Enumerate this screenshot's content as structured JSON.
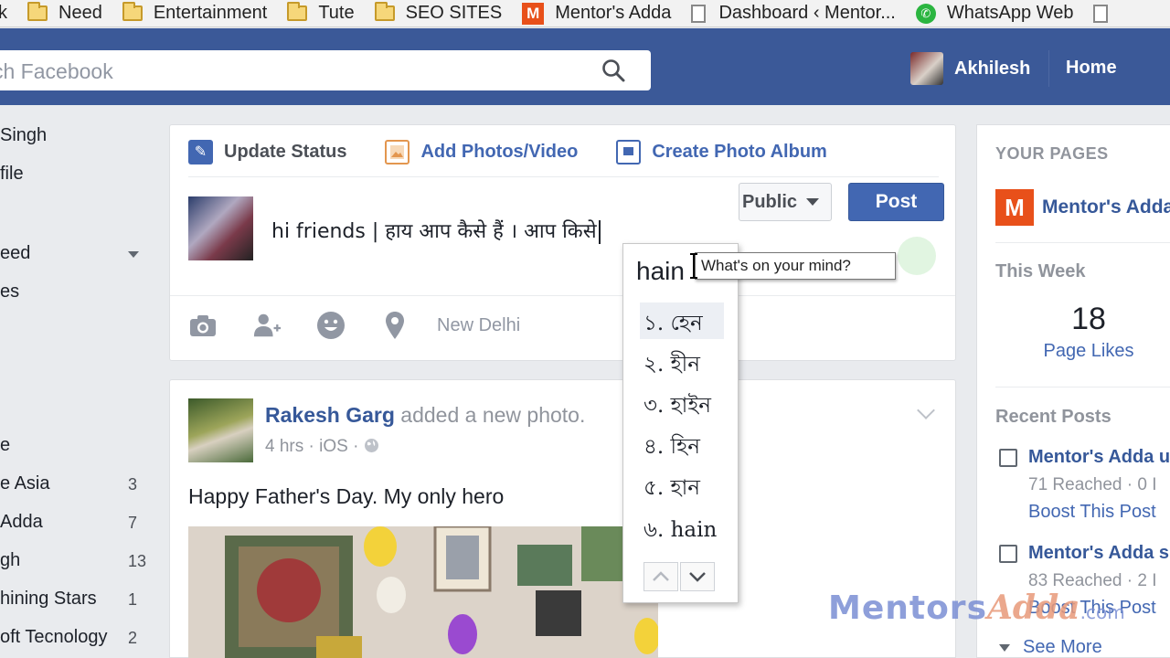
{
  "bookmarks": [
    {
      "label": "k",
      "icon": "none"
    },
    {
      "label": "Need",
      "icon": "folder-icon"
    },
    {
      "label": "Entertainment",
      "icon": "folder-icon"
    },
    {
      "label": "Tute",
      "icon": "folder-icon"
    },
    {
      "label": "SEO SITES",
      "icon": "folder-icon"
    },
    {
      "label": "Mentor's Adda",
      "icon": "mentors-adda-logo"
    },
    {
      "label": "Dashboard ‹ Mentor...",
      "icon": "page-icon"
    },
    {
      "label": "WhatsApp Web",
      "icon": "whatsapp-icon"
    }
  ],
  "topbar": {
    "search_placeholder": "ch Facebook",
    "user_name": "Akhilesh",
    "home_label": "Home"
  },
  "leftnav": {
    "items": [
      {
        "label": "Singh"
      },
      {
        "label": "file"
      },
      {
        "label": "eed"
      },
      {
        "label": "es"
      },
      {
        "label": "e"
      },
      {
        "label": "e Asia",
        "count": "3"
      },
      {
        "label": " Adda",
        "count": "7"
      },
      {
        "label": "gh",
        "count": "13"
      },
      {
        "label": "hining Stars",
        "count": "1"
      },
      {
        "label": "oft Tecnology",
        "count": "2"
      }
    ]
  },
  "composer": {
    "tabs": [
      {
        "label": "Update Status"
      },
      {
        "label": "Add Photos/Video"
      },
      {
        "label": "Create Photo Album"
      }
    ],
    "text": "hi friends | हाय आप कैसे हैं । आप किसे",
    "location": "New Delhi",
    "audience": "Public",
    "post_label": "Post"
  },
  "ime": {
    "typed": "hain",
    "suggestions": [
      "১. হেন",
      "২. হীন",
      "৩. হাইন",
      "৪. হিন",
      "৫. হান",
      "৬. hain"
    ],
    "selected_index": 0
  },
  "tooltip": "What's on your mind?",
  "feed": {
    "author": "Rakesh Garg",
    "action": "added a new photo.",
    "meta": "4 hrs · iOS ·",
    "text": "Happy Father's Day. My only hero"
  },
  "rightbar": {
    "pages_heading": "YOUR PAGES",
    "page_name": "Mentor's Adda",
    "this_week": "This Week",
    "likes_count": "18",
    "likes_label": "Page Likes",
    "recent_heading": "Recent Posts",
    "posts": [
      {
        "title": "Mentor's Adda u",
        "stat": "71 Reached · 0 I",
        "boost": "Boost This Post"
      },
      {
        "title": "Mentor's Adda s",
        "stat": "83 Reached · 2 I",
        "boost": "Boost This Post"
      }
    ],
    "see_more": "See More"
  },
  "watermark": {
    "part1": "Mentors",
    "part2": "Adda",
    "part3": ".com"
  },
  "colors": {
    "facebook_blue": "#3b5998",
    "link_blue": "#365899",
    "button_blue": "#4267b2",
    "brand_orange": "#e8501a"
  }
}
